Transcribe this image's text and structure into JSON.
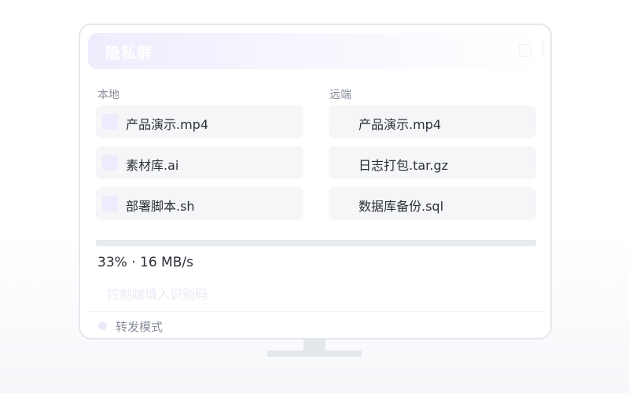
{
  "header": {
    "title": "隐私屏"
  },
  "local": {
    "label": "本地",
    "files": [
      {
        "name": "产品演示.mp4"
      },
      {
        "name": "素材库.ai"
      },
      {
        "name": "部署脚本.sh"
      }
    ]
  },
  "remote": {
    "label": "远端",
    "files": [
      {
        "name": "产品演示.mp4"
      },
      {
        "name": "日志打包.tar.gz"
      },
      {
        "name": "数据库备份.sql"
      }
    ]
  },
  "transfer": {
    "progress_percent": 33,
    "status_text": "33% · 16 MB/s"
  },
  "code_input": {
    "value": "",
    "placeholder": "控制端填入识别码"
  },
  "forward_mode": {
    "label": "转发模式"
  },
  "colors": {
    "accent_light": "#efeafc",
    "text_primary": "#2b2f36",
    "text_secondary": "#8a8f9c",
    "item_bg": "#f5f6f8"
  }
}
